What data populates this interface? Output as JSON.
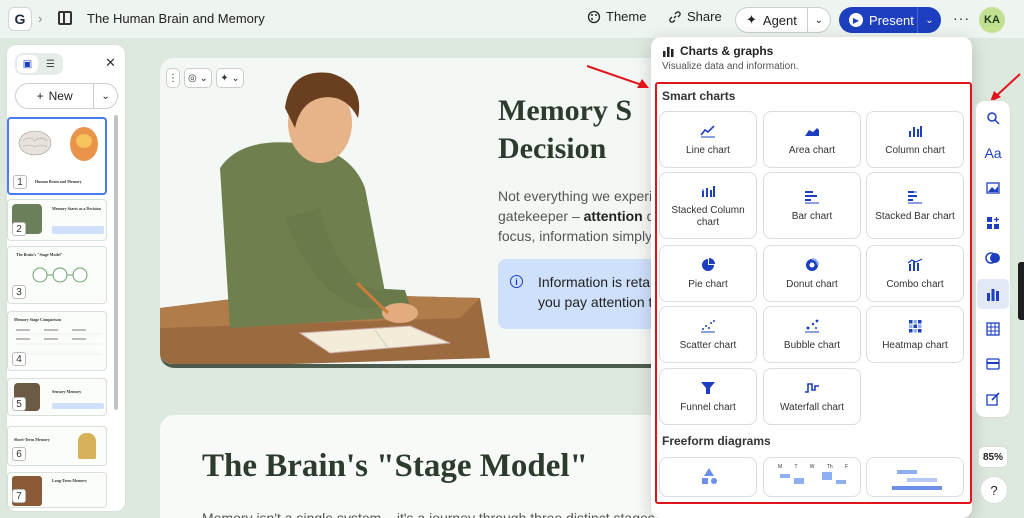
{
  "header": {
    "logo": "G",
    "breadcrumb_sep": "›",
    "doc_title": "The Human Brain and Memory",
    "theme_label": "Theme",
    "share_label": "Share",
    "agent_label": "Agent",
    "present_label": "Present",
    "more_label": "···",
    "avatar_initials": "KA"
  },
  "sidebar": {
    "new_label": "New",
    "slides": [
      {
        "num": "1",
        "title": "Human Brain and Memory"
      },
      {
        "num": "2",
        "title": "Memory Starts as a Decision"
      },
      {
        "num": "3",
        "title": "The Brain's \"Stage Model\""
      },
      {
        "num": "4",
        "title": "Memory Stage Comparison"
      },
      {
        "num": "5",
        "title": "Sensory Memory"
      },
      {
        "num": "6",
        "title": "Short-Term Memory"
      },
      {
        "num": "7",
        "title": "Long-Term Memory"
      }
    ]
  },
  "slide1": {
    "heading": "Memory S\nDecision",
    "para_before": "Not everything we experie",
    "para_line2_start": "gatekeeper – ",
    "para_bold": "attention",
    "para_line2_end": " de",
    "para_line3": "focus, information simply",
    "info_text": "Information is retai\nyou pay attention t"
  },
  "slide2": {
    "heading": "The Brain's \"Stage Model\"",
    "para": "Memory isn't a single system – it's a journey through three distinct stages, each with its own rules."
  },
  "popup": {
    "title": "Charts & graphs",
    "subtitle": "Visualize data and information.",
    "smart_label": "Smart charts",
    "freeform_label": "Freeform diagrams",
    "charts": [
      {
        "label": "Line chart",
        "icon": "line-chart-icon"
      },
      {
        "label": "Area chart",
        "icon": "area-chart-icon"
      },
      {
        "label": "Column chart",
        "icon": "column-chart-icon"
      },
      {
        "label": "Stacked Column chart",
        "icon": "stacked-column-chart-icon"
      },
      {
        "label": "Bar chart",
        "icon": "bar-chart-icon"
      },
      {
        "label": "Stacked Bar chart",
        "icon": "stacked-bar-chart-icon"
      },
      {
        "label": "Pie chart",
        "icon": "pie-chart-icon"
      },
      {
        "label": "Donut chart",
        "icon": "donut-chart-icon"
      },
      {
        "label": "Combo chart",
        "icon": "combo-chart-icon"
      },
      {
        "label": "Scatter chart",
        "icon": "scatter-chart-icon"
      },
      {
        "label": "Bubble chart",
        "icon": "bubble-chart-icon"
      },
      {
        "label": "Heatmap chart",
        "icon": "heatmap-chart-icon"
      },
      {
        "label": "Funnel chart",
        "icon": "funnel-chart-icon"
      },
      {
        "label": "Waterfall chart",
        "icon": "waterfall-chart-icon"
      }
    ],
    "freeform_week_days": [
      "M",
      "T",
      "W",
      "Th",
      "F"
    ]
  },
  "right_toolbar": {
    "text_tool_label": "Aa",
    "zoom": "85%",
    "help": "?"
  },
  "colors": {
    "accent": "#1d3fbf",
    "highlight": "#e0141b",
    "background": "#dde8df"
  }
}
